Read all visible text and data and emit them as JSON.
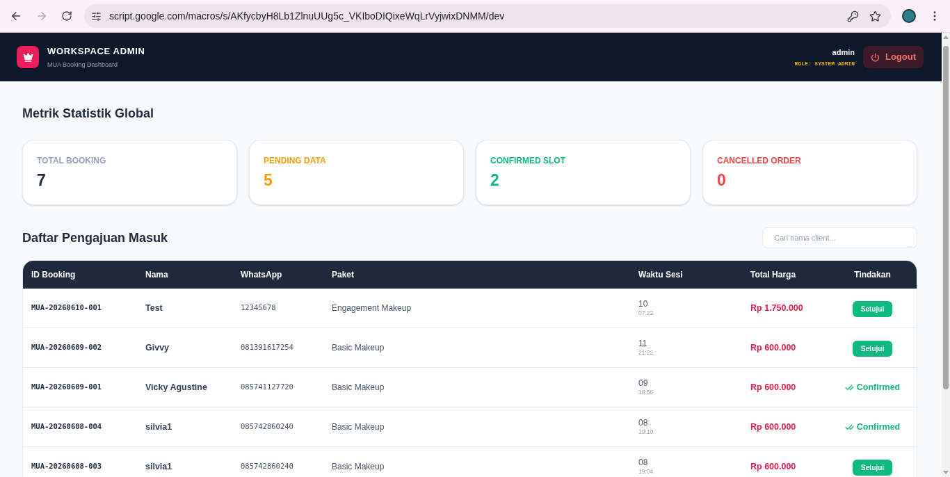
{
  "browser": {
    "url": "script.google.com/macros/s/AKfycbyH8Lb1ZlnuUUg5c_VKIboDIQixeWqLrVyjwixDNMM/dev",
    "forward_disabled": true
  },
  "header": {
    "title": "WORKSPACE ADMIN",
    "subtitle": "MUA Booking Dashboard",
    "user": "admin",
    "role": "ROLE: SYSTEM ADMIN",
    "logout": "Logout"
  },
  "stats": {
    "title": "Metrik Statistik Global",
    "cards": [
      {
        "kind": "total",
        "label": "TOTAL BOOKING",
        "value": "7",
        "color": "#94a3b8"
      },
      {
        "kind": "status",
        "label": "PENDING DATA",
        "value": "5",
        "color": "#f59e0b"
      },
      {
        "kind": "status",
        "label": "CONFIRMED SLOT",
        "value": "2",
        "color": "#10b981"
      },
      {
        "kind": "status",
        "label": "CANCELLED ORDER",
        "value": "0",
        "color": "#ef4444"
      }
    ]
  },
  "requests": {
    "title": "Daftar Pengajuan Masuk",
    "search": {
      "placeholder": "Cari nama client..."
    },
    "table": {
      "columns": [
        "ID Booking",
        "Nama",
        "WhatsApp",
        "Paket",
        "Waktu Sesi",
        "Total Harga",
        "Tindakan"
      ],
      "rows": [
        {
          "id": "MUA-20260610-001",
          "name": "Test",
          "whatsapp": "12345678",
          "package": "Engagement Makeup",
          "day": "10",
          "time": "07:22",
          "price": "Rp 1.750.000",
          "action": {
            "kind": "button",
            "label": "Setujui"
          }
        },
        {
          "id": "MUA-20260609-002",
          "name": "Givvy",
          "whatsapp": "081391617254",
          "package": "Basic Makeup",
          "day": "11",
          "time": "21:22",
          "price": "Rp 600.000",
          "action": {
            "kind": "button",
            "label": "Setujui"
          }
        },
        {
          "id": "MUA-20260609-001",
          "name": "Vicky Agustine",
          "whatsapp": "085741127720",
          "package": "Basic Makeup",
          "day": "09",
          "time": "18:55",
          "price": "Rp 600.000",
          "action": {
            "kind": "status",
            "label": "Confirmed"
          }
        },
        {
          "id": "MUA-20260608-004",
          "name": "silvia1",
          "whatsapp": "085742860240",
          "package": "Basic Makeup",
          "day": "08",
          "time": "19:10",
          "price": "Rp 600.000",
          "action": {
            "kind": "status",
            "label": "Confirmed"
          }
        },
        {
          "id": "MUA-20260608-003",
          "name": "silvia1",
          "whatsapp": "085742860240",
          "package": "Basic Makeup",
          "day": "08",
          "time": "19:04",
          "price": "Rp 600.000",
          "action": {
            "kind": "button",
            "label": "Setujui"
          }
        }
      ]
    }
  }
}
